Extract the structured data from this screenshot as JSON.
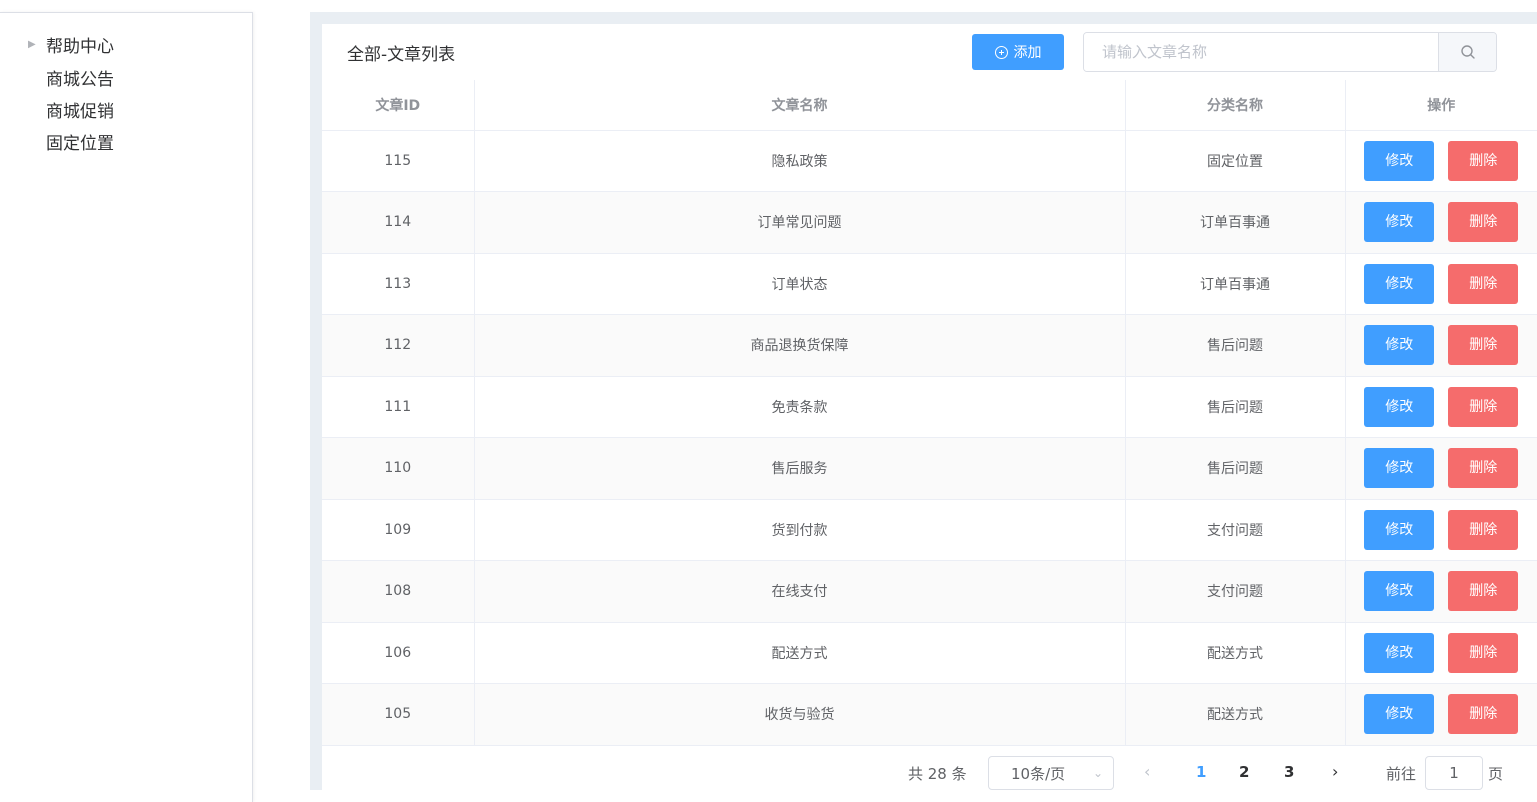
{
  "sidebar": {
    "root": {
      "label": "帮助中心"
    },
    "children": [
      {
        "label": "商城公告"
      },
      {
        "label": "商城促销"
      },
      {
        "label": "固定位置"
      }
    ]
  },
  "toolbar": {
    "title": "全部-文章列表",
    "add_label": "添加",
    "search_placeholder": "请输入文章名称",
    "search_value": ""
  },
  "table": {
    "columns": [
      "文章ID",
      "文章名称",
      "分类名称",
      "操作"
    ],
    "edit_label": "修改",
    "delete_label": "删除",
    "rows": [
      {
        "id": "115",
        "name": "隐私政策",
        "category": "固定位置"
      },
      {
        "id": "114",
        "name": "订单常见问题",
        "category": "订单百事通"
      },
      {
        "id": "113",
        "name": "订单状态",
        "category": "订单百事通"
      },
      {
        "id": "112",
        "name": "商品退换货保障",
        "category": "售后问题"
      },
      {
        "id": "111",
        "name": "免责条款",
        "category": "售后问题"
      },
      {
        "id": "110",
        "name": "售后服务",
        "category": "售后问题"
      },
      {
        "id": "109",
        "name": "货到付款",
        "category": "支付问题"
      },
      {
        "id": "108",
        "name": "在线支付",
        "category": "支付问题"
      },
      {
        "id": "106",
        "name": "配送方式",
        "category": "配送方式"
      },
      {
        "id": "105",
        "name": "收货与验货",
        "category": "配送方式"
      }
    ]
  },
  "pagination": {
    "total_label": "共 28 条",
    "page_size": "10条/页",
    "pages": [
      "1",
      "2",
      "3"
    ],
    "current_page": "1",
    "goto_label": "前往",
    "goto_value": "1",
    "goto_suffix": "页"
  },
  "colors": {
    "primary": "#409eff",
    "danger": "#f56c6c",
    "page_bg": "#e9eef3"
  }
}
